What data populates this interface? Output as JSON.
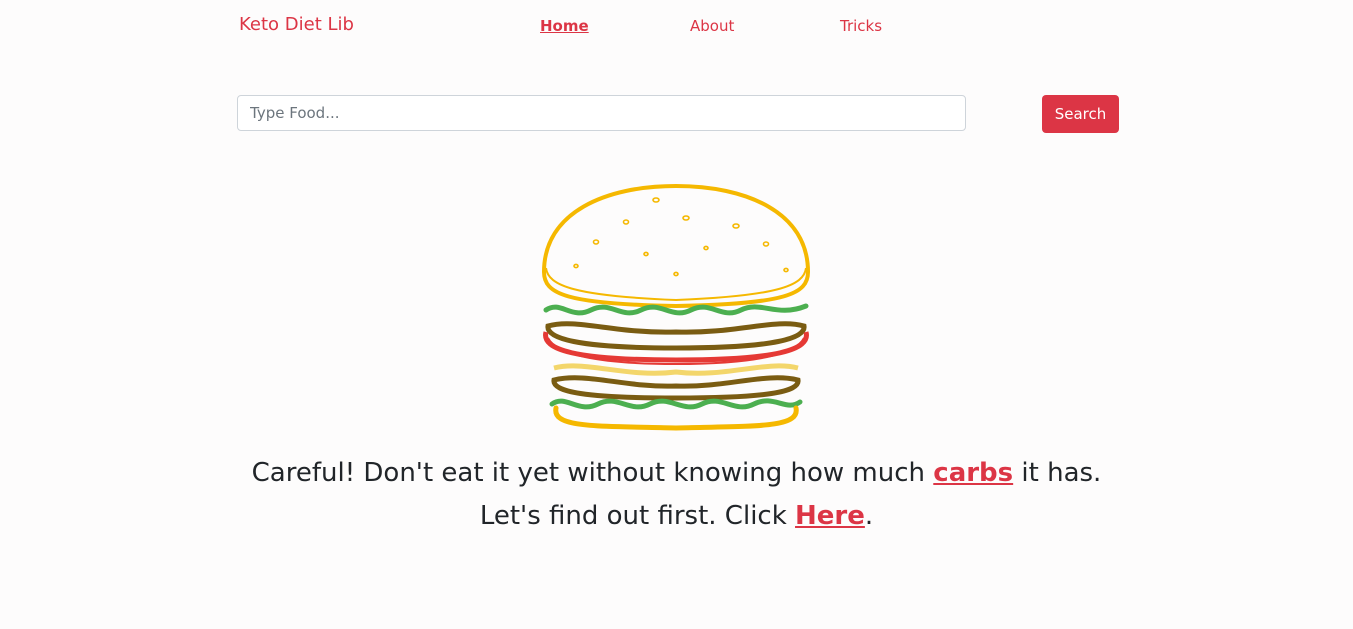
{
  "navbar": {
    "brand": "Keto Diet Lib",
    "links": [
      {
        "label": "Home",
        "active": true
      },
      {
        "label": "About",
        "active": false
      },
      {
        "label": "Tricks",
        "active": false
      }
    ]
  },
  "search": {
    "placeholder": "Type Food...",
    "value": "",
    "button_label": "Search"
  },
  "hero": {
    "image": "burger-illustration",
    "line1_prefix": "Careful! Don't eat it yet without knowing how much ",
    "line1_link": "carbs",
    "line1_suffix": " it has.",
    "line2_prefix": "Let's find out first. Click ",
    "line2_link": "Here",
    "line2_suffix": "."
  },
  "colors": {
    "accent": "#dc3545",
    "text": "#212529",
    "bun": "#f5b800",
    "lettuce": "#4caf50",
    "patty": "#7a5c12",
    "tomato": "#e53935",
    "cheese": "#f3d66b"
  }
}
